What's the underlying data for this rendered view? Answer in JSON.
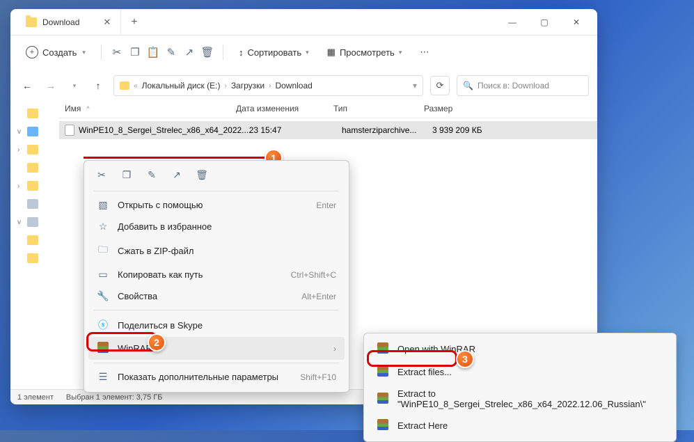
{
  "tab": {
    "title": "Download"
  },
  "toolbar": {
    "create": "Создать",
    "sort": "Сортировать",
    "view": "Просмотреть"
  },
  "breadcrumb": {
    "parts": [
      "Локальный диск (E:)",
      "Загрузки",
      "Download"
    ]
  },
  "search": {
    "placeholder": "Поиск в: Download"
  },
  "columns": {
    "name": "Имя",
    "date": "Дата изменения",
    "type": "Тип",
    "size": "Размер"
  },
  "file": {
    "name": "WinPE10_8_Sergei_Strelec_x86_x64_2022....",
    "date_partial": "23 15:47",
    "type": "hamsterziparchive...",
    "size": "3 939 209 КБ"
  },
  "context": {
    "open_with": "Открыть с помощью",
    "favorites": "Добавить в избранное",
    "zip": "Сжать в ZIP-файл",
    "copy_path": "Копировать как путь",
    "copy_path_sc": "Ctrl+Shift+C",
    "properties": "Свойства",
    "properties_sc": "Alt+Enter",
    "skype": "Поделиться в Skype",
    "winrar": "WinRAR",
    "more": "Показать дополнительные параметры",
    "more_sc": "Shift+F10",
    "enter": "Enter"
  },
  "rar_menu": {
    "open": "Open with WinRAR",
    "extract": "Extract files...",
    "extract_to": "Extract to \"WinPE10_8_Sergei_Strelec_x86_x64_2022.12.06_Russian\\\"",
    "extract_here": "Extract Here"
  },
  "status": {
    "count": "1 элемент",
    "selected": "Выбран 1 элемент: 3,75 ГБ"
  },
  "badges": {
    "one": "1",
    "two": "2",
    "three": "3"
  }
}
